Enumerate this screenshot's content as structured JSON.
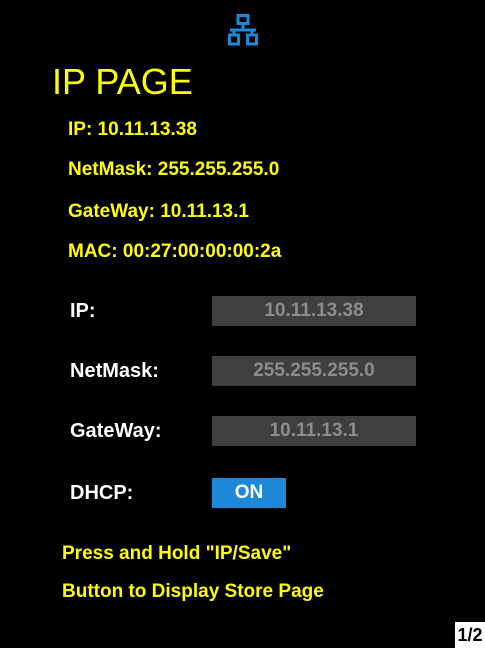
{
  "header": {
    "icon": "network-icon",
    "icon_color": "#1e88d8",
    "title": "IP PAGE"
  },
  "current": {
    "ip": "IP: 10.11.13.38",
    "netmask": "NetMask: 255.255.255.0",
    "gateway": "GateWay: 10.11.13.1",
    "mac": "MAC: 00:27:00:00:00:2a"
  },
  "settings": {
    "ip_label": "IP:",
    "ip_value": "10.11.13.38",
    "netmask_label": "NetMask:",
    "netmask_value": "255.255.255.0",
    "gateway_label": "GateWay:",
    "gateway_value": "10.11.13.1",
    "dhcp_label": "DHCP:",
    "dhcp_value": "ON"
  },
  "hint": {
    "line1": "Press and Hold \"IP/Save\"",
    "line2": "Button to Display Store Page"
  },
  "pagination": {
    "indicator": "1/2"
  },
  "colors": {
    "background": "#000000",
    "title": "#ffff00",
    "label": "#ffffff",
    "field_bg": "#3f3f3f",
    "field_text": "#8c8c8c",
    "accent": "#1e88d8"
  }
}
